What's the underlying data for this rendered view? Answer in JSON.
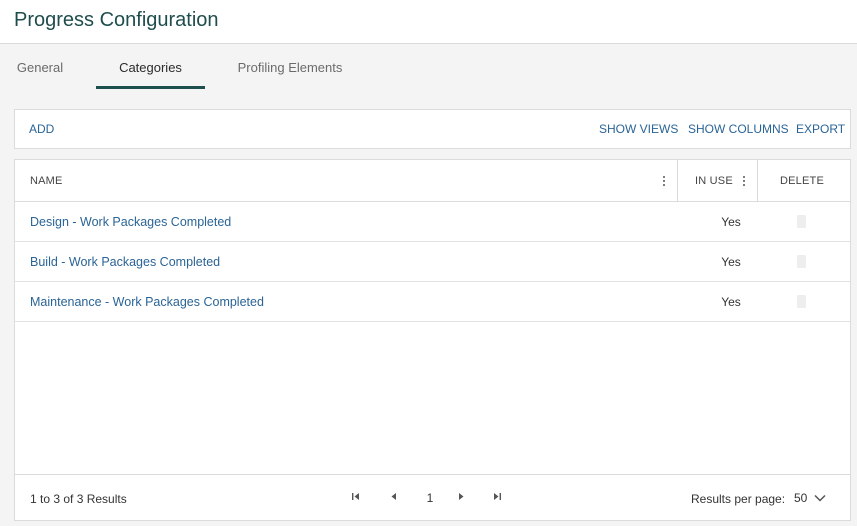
{
  "page": {
    "title": "Progress Configuration"
  },
  "tabs": [
    {
      "label": "General",
      "active": false
    },
    {
      "label": "Categories",
      "active": true
    },
    {
      "label": "Profiling Elements",
      "active": false
    }
  ],
  "toolbar": {
    "add_label": "ADD",
    "show_views_label": "SHOW VIEWS",
    "show_columns_label": "SHOW COLUMNS",
    "export_label": "EXPORT"
  },
  "grid": {
    "columns": {
      "name": "NAME",
      "in_use": "IN USE",
      "delete": "DELETE"
    },
    "rows": [
      {
        "name": "Design - Work Packages Completed",
        "in_use": "Yes"
      },
      {
        "name": "Build - Work Packages Completed",
        "in_use": "Yes"
      },
      {
        "name": "Maintenance - Work Packages Completed",
        "in_use": "Yes"
      }
    ]
  },
  "pagination": {
    "summary": "1 to 3 of 3 Results",
    "current_page": "1",
    "results_per_page_label": "Results per page:",
    "results_per_page_value": "50"
  },
  "icons": {
    "first": "first-page-icon",
    "prev": "previous-page-icon",
    "next": "next-page-icon",
    "last": "last-page-icon",
    "menu": "column-menu-icon",
    "delete": "delete-icon",
    "dropdown": "chevron-down-icon"
  },
  "colors": {
    "title": "#1f4d4d",
    "accent": "#1e4f4f",
    "link": "#2a6496",
    "background": "#f3f4f3"
  }
}
